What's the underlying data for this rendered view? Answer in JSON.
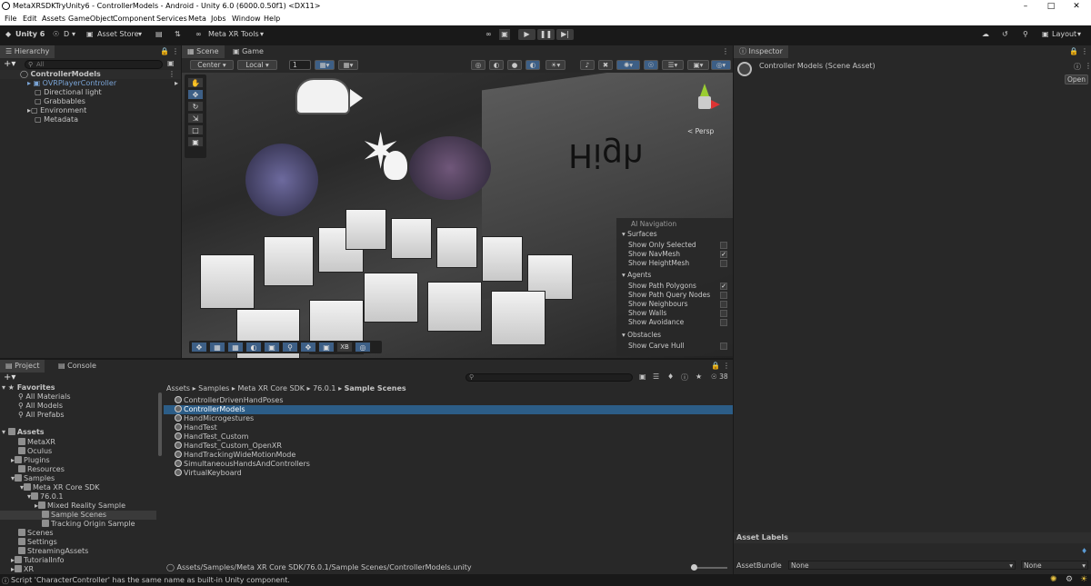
{
  "window": {
    "title": "MetaXRSDKTryUnity6 - ControllerModels - Android - Unity 6.0 (6000.0.50f1) <DX11>"
  },
  "menu": [
    "File",
    "Edit",
    "Assets",
    "GameObject",
    "Component",
    "Services",
    "Meta",
    "Jobs",
    "Window",
    "Help"
  ],
  "toolbar": {
    "unity_label": "Unity 6",
    "account": "D",
    "asset_store": "Asset Store",
    "meta_xr": "Meta XR Tools",
    "layout": "Layout"
  },
  "hierarchy": {
    "tab": "Hierarchy",
    "search_placeholder": "All",
    "items": [
      "ControllerModels",
      "OVRPlayerController",
      "Directional light",
      "Grabbables",
      "Environment",
      "Metadata"
    ]
  },
  "scene": {
    "tabs": [
      "Scene",
      "Game"
    ],
    "pivot": "Center",
    "space": "Local",
    "grid_value": "1",
    "persp": "Persp",
    "wall_text": "High",
    "ai_nav": {
      "title": "AI Navigation",
      "surfaces": "Surfaces",
      "show_only_selected": "Show Only Selected",
      "show_navmesh": "Show NavMesh",
      "show_heightmesh": "Show HeightMesh",
      "agents": "Agents",
      "show_path_polygons": "Show Path Polygons",
      "show_path_query_nodes": "Show Path Query Nodes",
      "show_neighbours": "Show Neighbours",
      "show_walls": "Show Walls",
      "show_avoidance": "Show Avoidance",
      "obstacles": "Obstacles",
      "show_carve_hull": "Show Carve Hull"
    },
    "xr_button": "XB"
  },
  "inspector": {
    "tab": "Inspector",
    "title": "Controller Models (Scene Asset)",
    "open": "Open",
    "asset_labels": "Asset Labels",
    "assetbundle_label": "AssetBundle",
    "bundle_value": "None",
    "variant_value": "None"
  },
  "project": {
    "tabs": [
      "Project",
      "Console"
    ],
    "count": "38",
    "breadcrumb": [
      "Assets",
      "Samples",
      "Meta XR Core SDK",
      "76.0.1",
      "Sample Scenes"
    ],
    "favorites": {
      "title": "Favorites",
      "items": [
        "All Materials",
        "All Models",
        "All Prefabs"
      ]
    },
    "tree": {
      "assets": "Assets",
      "metaxr": "MetaXR",
      "oculus": "Oculus",
      "plugins": "Plugins",
      "resources": "Resources",
      "samples": "Samples",
      "core_sdk": "Meta XR Core SDK",
      "version": "76.0.1",
      "mixed_reality": "Mixed Reality Sample",
      "sample_scenes": "Sample Scenes",
      "tracking_origin": "Tracking Origin Sample",
      "scenes": "Scenes",
      "settings": "Settings",
      "streaming": "StreamingAssets",
      "tutorialinfo": "TutorialInfo",
      "xr": "XR"
    },
    "files": [
      "ControllerDrivenHandPoses",
      "ControllerModels",
      "HandMicrogestures",
      "HandTest",
      "HandTest_Custom",
      "HandTest_Custom_OpenXR",
      "HandTrackingWideMotionMode",
      "SimultaneousHandsAndControllers",
      "VirtualKeyboard"
    ],
    "path": "Assets/Samples/Meta XR Core SDK/76.0.1/Sample Scenes/ControllerModels.unity"
  },
  "status": {
    "message": "Script 'CharacterController' has the same name as built-in Unity component."
  }
}
